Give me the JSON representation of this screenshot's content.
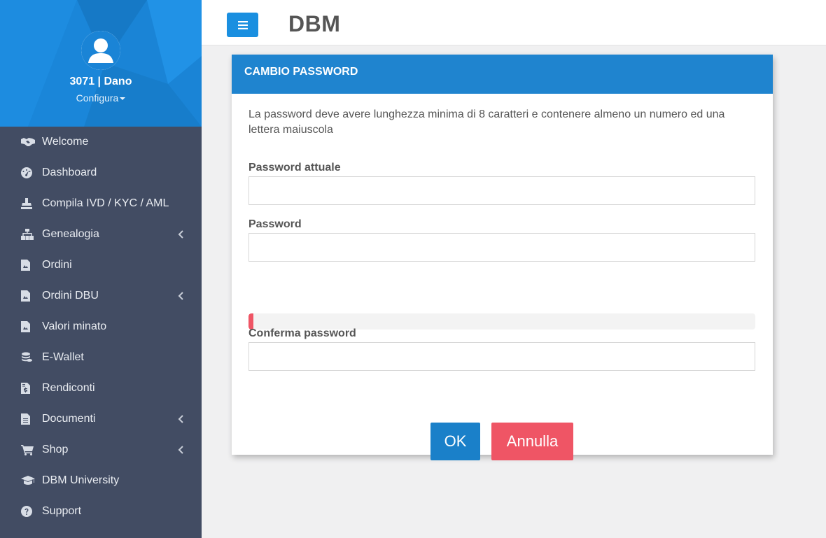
{
  "sidebar": {
    "user": "3071 | Dano",
    "config_label": "Configura",
    "items": [
      {
        "label": "Welcome",
        "icon": "handshake-icon",
        "submenu": false
      },
      {
        "label": "Dashboard",
        "icon": "dashboard-icon",
        "submenu": false
      },
      {
        "label": "Compila IVD / KYC / AML",
        "icon": "stamp-icon",
        "submenu": false
      },
      {
        "label": "Genealogia",
        "icon": "sitemap-icon",
        "submenu": true
      },
      {
        "label": "Ordini",
        "icon": "file-icon",
        "submenu": false
      },
      {
        "label": "Ordini DBU",
        "icon": "file-icon",
        "submenu": true
      },
      {
        "label": "Valori minato",
        "icon": "file-icon",
        "submenu": false
      },
      {
        "label": "E-Wallet",
        "icon": "coins-icon",
        "submenu": false
      },
      {
        "label": "Rendiconti",
        "icon": "invoice-icon",
        "submenu": false
      },
      {
        "label": "Documenti",
        "icon": "document-icon",
        "submenu": true
      },
      {
        "label": "Shop",
        "icon": "cart-icon",
        "submenu": true
      },
      {
        "label": "DBM University",
        "icon": "graduation-cap-icon",
        "submenu": false
      },
      {
        "label": "Support",
        "icon": "question-circle-icon",
        "submenu": false
      }
    ]
  },
  "header": {
    "brand": "DBM",
    "menu_button_icon": "hamburger-icon"
  },
  "card": {
    "title": "CAMBIO PASSWORD",
    "notice": "La password deve avere lunghezza minima di 8 caratteri e contenere almeno un numero ed una lettera maiuscola",
    "fields": {
      "current_label": "Password attuale",
      "current_value": "",
      "new_label": "Password",
      "new_value": "",
      "confirm_label": "Conferma password",
      "confirm_value": ""
    },
    "strength": {
      "fraction": 0.01,
      "color": "#ef5565"
    },
    "ok_label": "OK",
    "cancel_label": "Annulla"
  },
  "colors": {
    "sidebar_bg": "#424c63",
    "profile_bg": "#1a84d6",
    "card_header": "#1f84cf",
    "ok": "#1a80c9",
    "cancel": "#ef5565"
  }
}
